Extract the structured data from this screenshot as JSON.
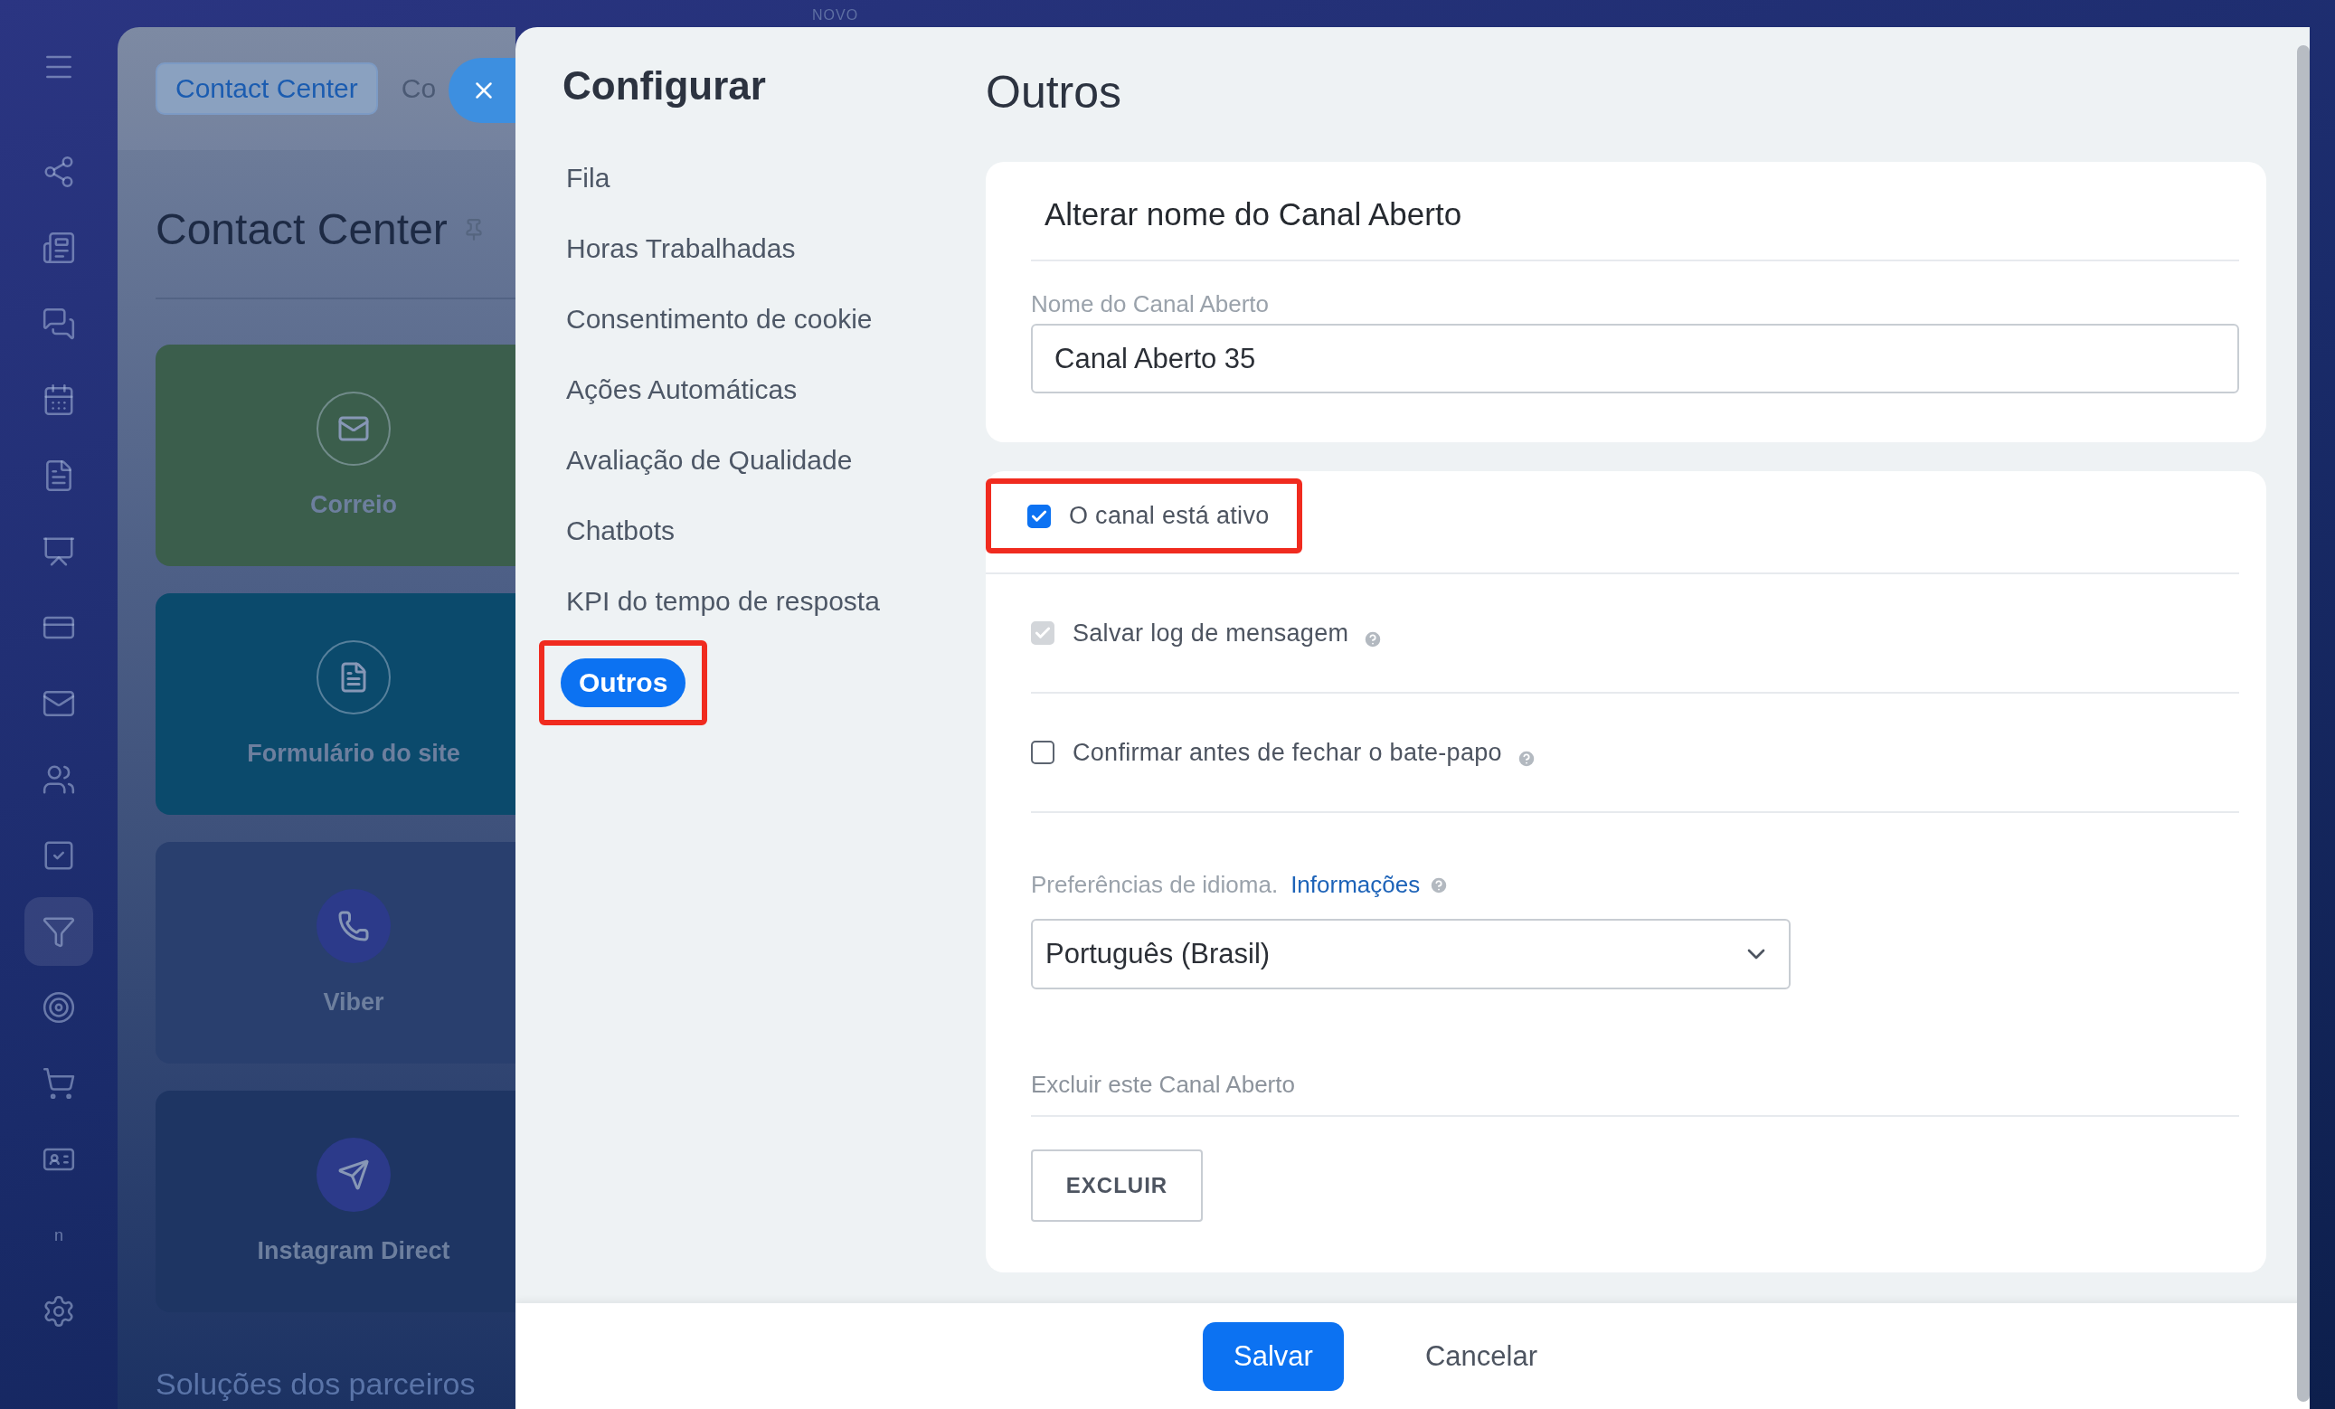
{
  "rail": {
    "items": [
      {
        "kind": "menu",
        "selected": false
      },
      {
        "kind": "nodes",
        "selected": false
      },
      {
        "kind": "news",
        "selected": false
      },
      {
        "kind": "chat",
        "selected": false
      },
      {
        "kind": "calendar",
        "selected": false
      },
      {
        "kind": "document",
        "selected": false
      },
      {
        "kind": "board",
        "selected": false
      },
      {
        "kind": "card",
        "selected": false
      },
      {
        "kind": "mail",
        "selected": false
      },
      {
        "kind": "users",
        "selected": false
      },
      {
        "kind": "task",
        "selected": false
      },
      {
        "kind": "funnel",
        "selected": true
      },
      {
        "kind": "target",
        "selected": false
      },
      {
        "kind": "cart",
        "selected": false
      },
      {
        "kind": "id",
        "selected": false
      },
      {
        "kind": "text",
        "label": "n",
        "selected": false
      },
      {
        "kind": "settings",
        "selected": false
      }
    ]
  },
  "background": {
    "top_label": "NOVO",
    "breadcrumb": [
      {
        "label": "Contact Center",
        "selected": true
      },
      {
        "label": "Co",
        "selected": false
      }
    ],
    "title": "Contact Center",
    "tiles": [
      {
        "label": "Correio",
        "kind": "mail",
        "color": "#3b5e4c"
      },
      {
        "label": "Formulário do site",
        "kind": "form",
        "color": "#0b4a6c"
      },
      {
        "label": "Viber",
        "kind": "viber",
        "color": "#293f6e"
      },
      {
        "label": "Instagram Direct",
        "kind": "instagram",
        "color": "#1e3563"
      }
    ],
    "footer_text": "Soluções dos parceiros"
  },
  "settings": {
    "title": "Configurar",
    "nav": [
      {
        "label": "Fila",
        "selected": false,
        "highlighted": false
      },
      {
        "label": "Horas Trabalhadas",
        "selected": false,
        "highlighted": false
      },
      {
        "label": "Consentimento de cookie",
        "selected": false,
        "highlighted": false
      },
      {
        "label": "Ações Automáticas",
        "selected": false,
        "highlighted": false
      },
      {
        "label": "Avaliação de Qualidade",
        "selected": false,
        "highlighted": false
      },
      {
        "label": "Chatbots",
        "selected": false,
        "highlighted": false
      },
      {
        "label": "KPI do tempo de resposta",
        "selected": false,
        "highlighted": false
      },
      {
        "label": "Outros",
        "selected": true,
        "highlighted": true
      }
    ]
  },
  "content": {
    "title": "Outros",
    "rename_card": {
      "title": "Alterar nome do Canal Aberto",
      "field_label": "Nome do Canal Aberto",
      "value": "Canal Aberto 35"
    },
    "options": [
      {
        "label": "O canal está ativo",
        "checked": true,
        "disabled": false,
        "help": false,
        "highlighted": true
      },
      {
        "label": "Salvar log de mensagem",
        "checked": true,
        "disabled": true,
        "help": true,
        "highlighted": false
      },
      {
        "label": "Confirmar antes de fechar o bate-papo",
        "checked": false,
        "disabled": false,
        "help": true,
        "highlighted": false
      }
    ],
    "language": {
      "label": "Preferências de idioma.",
      "link": "Informações",
      "value": "Português (Brasil)"
    },
    "delete": {
      "label": "Excluir este Canal Aberto",
      "button": "EXCLUIR"
    }
  },
  "footer": {
    "buttons": [
      {
        "label": "Salvar",
        "kind": "primary"
      },
      {
        "label": "Cancelar",
        "kind": "plain"
      }
    ]
  }
}
